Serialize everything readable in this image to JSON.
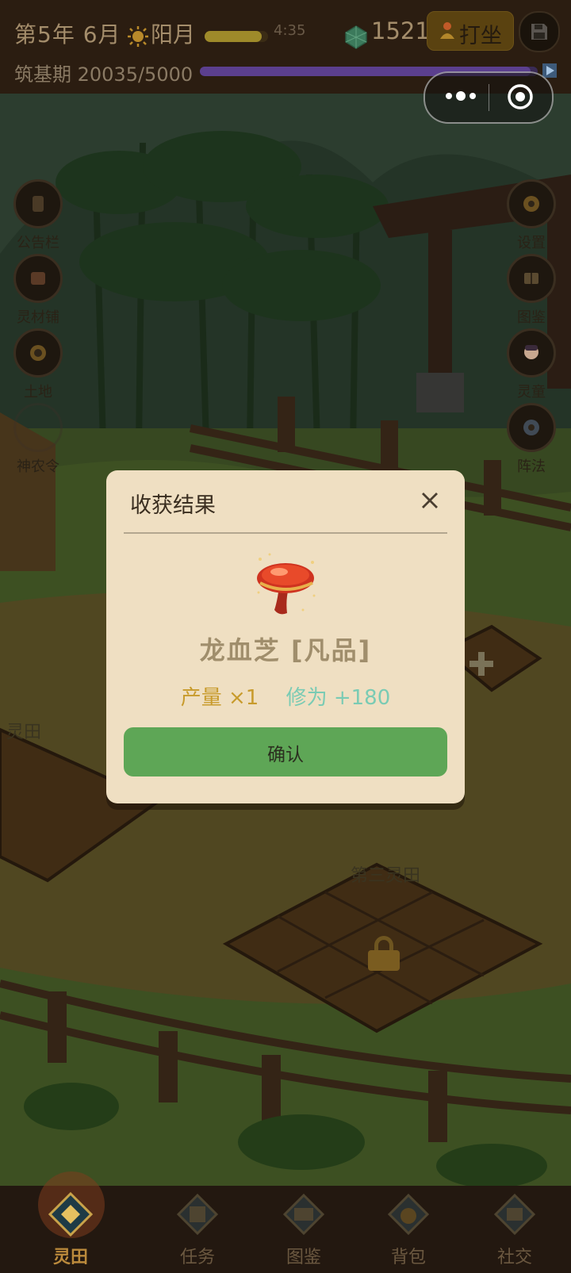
{
  "topbar": {
    "date": "第5年 6月",
    "moon": "阳月",
    "clock": "4:35",
    "day_progress": 0.9,
    "gems": "1521",
    "meditate_label": "打坐",
    "realm": "筑基期 20035/5000",
    "exp_progress": 0.98
  },
  "side_left": [
    {
      "label": "公告栏",
      "icon": "bulletin-icon"
    },
    {
      "label": "灵材铺",
      "icon": "material-shop-icon"
    },
    {
      "label": "土地",
      "icon": "land-icon"
    },
    {
      "label": "神农令",
      "icon": "shennong-icon"
    }
  ],
  "side_right": [
    {
      "label": "设置",
      "icon": "settings-icon"
    },
    {
      "label": "图鉴",
      "icon": "codex-icon"
    },
    {
      "label": "灵童",
      "icon": "spirit-child-icon"
    },
    {
      "label": "阵法",
      "icon": "formation-icon"
    }
  ],
  "field_labels": [
    "灵田",
    "第三灵田"
  ],
  "dialog": {
    "title": "收获结果",
    "item_name": "龙血芝 [凡品]",
    "yield_text": "产量 ×1",
    "cultivation_text": "修为 +180",
    "confirm_label": "确认"
  },
  "nav": [
    {
      "label": "灵田",
      "icon": "spirit-field-icon",
      "active": true
    },
    {
      "label": "任务",
      "icon": "task-icon",
      "active": false
    },
    {
      "label": "图鉴",
      "icon": "codex-icon",
      "active": false
    },
    {
      "label": "背包",
      "icon": "bag-icon",
      "active": false
    },
    {
      "label": "社交",
      "icon": "social-icon",
      "active": false
    }
  ],
  "colors": {
    "dialog_bg": "#efdfc2",
    "confirm_green": "#5ea656",
    "yield_gold": "#c89b2c",
    "cultivation_teal": "#7acbb4",
    "active_nav": "#bb8a3c"
  }
}
